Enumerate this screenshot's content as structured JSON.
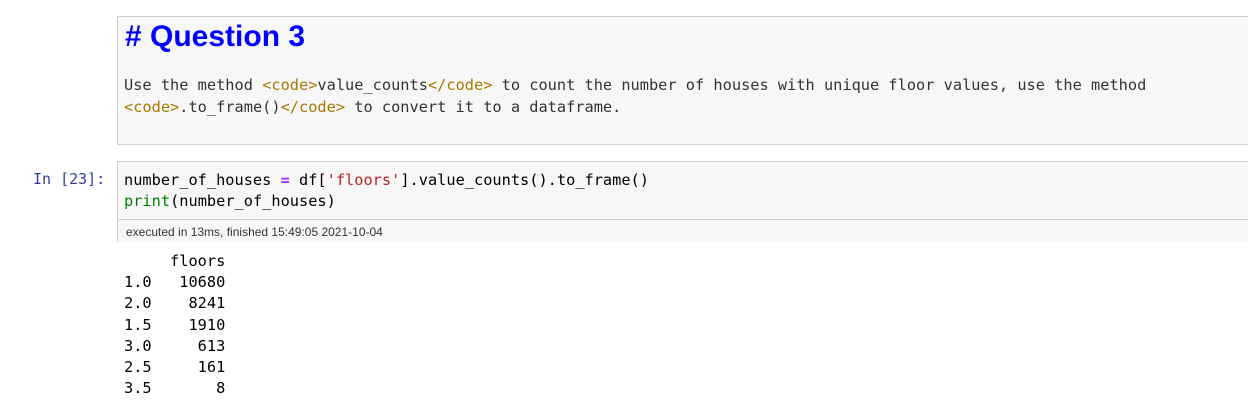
{
  "markdown_cell": {
    "heading": "# Question 3",
    "line1": {
      "a": "Use the method ",
      "code_open": "<code>",
      "b": "value_counts",
      "code_close": "</code>",
      "c": " to count the number of houses with unique floor values, use the method"
    },
    "line2": {
      "code_open": "<code>",
      "a": ".to_frame()",
      "code_close": "</code>",
      "b": " to convert it to a dataframe."
    }
  },
  "code_cell": {
    "prompt": "In [23]:",
    "line1": {
      "var": "number_of_houses ",
      "eq": "=",
      "mid": " df[",
      "str": "'floors'",
      "end": "].value_counts().to_frame()"
    },
    "line2": {
      "fn": "print",
      "rest": "(number_of_houses)"
    },
    "execution_info": "executed in 13ms, finished 15:49:05 2021-10-04"
  },
  "output": {
    "header": "     floors",
    "rows": [
      "1.0   10680",
      "2.0    8241",
      "1.5    1910",
      "3.0     613",
      "2.5     161",
      "3.5       8"
    ]
  }
}
